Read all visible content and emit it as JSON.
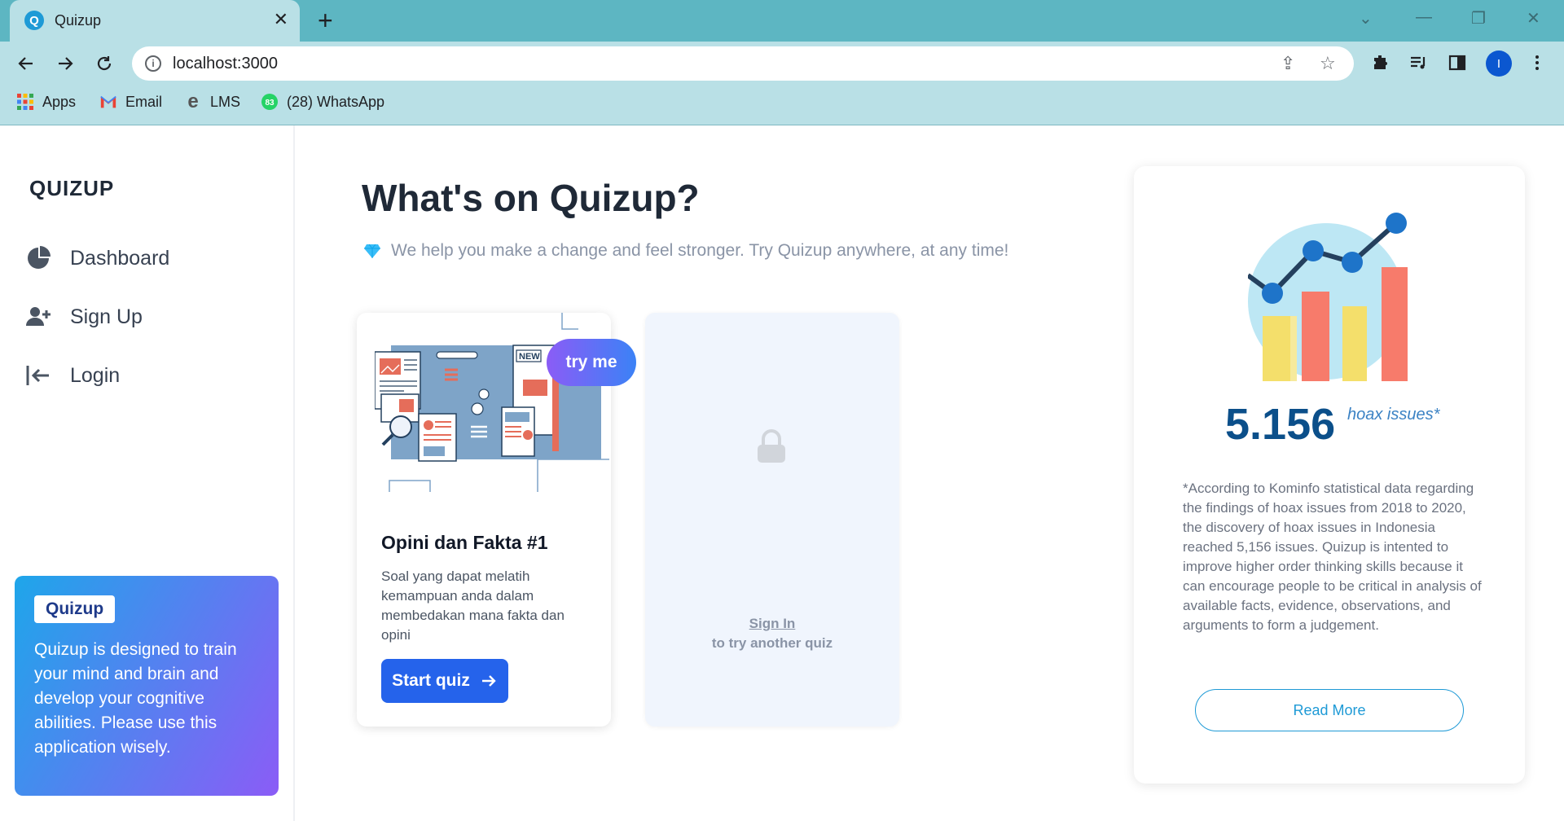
{
  "browser": {
    "tab_title": "Quizup",
    "favicon_letter": "Q",
    "url": "localhost:3000",
    "profile_initial": "I",
    "bookmarks": [
      {
        "label": "Apps"
      },
      {
        "label": "Email"
      },
      {
        "label": "LMS"
      },
      {
        "label": "(28) WhatsApp",
        "badge": "83"
      }
    ]
  },
  "sidebar": {
    "logo": "QUIZUP",
    "items": [
      {
        "label": "Dashboard",
        "icon": "pie-chart-icon"
      },
      {
        "label": "Sign Up",
        "icon": "user-plus-icon"
      },
      {
        "label": "Login",
        "icon": "login-arrow-icon"
      }
    ],
    "promo": {
      "badge": "Quizup",
      "text": "Quizup is designed to train your mind and brain and develop your cognitive abilities. Please use this application wisely."
    }
  },
  "main": {
    "title": "What's on Quizup?",
    "subtitle": "We help you make a change and feel stronger. Try Quizup anywhere, at any time!",
    "quiz_card": {
      "badge": "try me",
      "news_label": "NEW",
      "title": "Opini dan Fakta #1",
      "description": "Soal yang dapat melatih kemampuan anda dalam membedakan mana fakta dan opini",
      "button": "Start quiz"
    },
    "locked_card": {
      "link": "Sign In",
      "text": "to try another quiz"
    }
  },
  "stats": {
    "number": "5.156",
    "label": "hoax issues*",
    "description": "*According to Kominfo statistical data regarding the findings of hoax issues from 2018 to 2020, the discovery of hoax issues in Indonesia reached 5,156 issues. Quizup is intented to improve higher order thinking skills because it can encourage people to be critical in analysis of available facts, evidence, observations, and arguments to form a judgement.",
    "button": "Read More"
  },
  "colors": {
    "tab_strip": "#5db6c2",
    "toolbar": "#b9e0e6",
    "primary": "#2563eb",
    "accent": "#1e9ad6"
  }
}
